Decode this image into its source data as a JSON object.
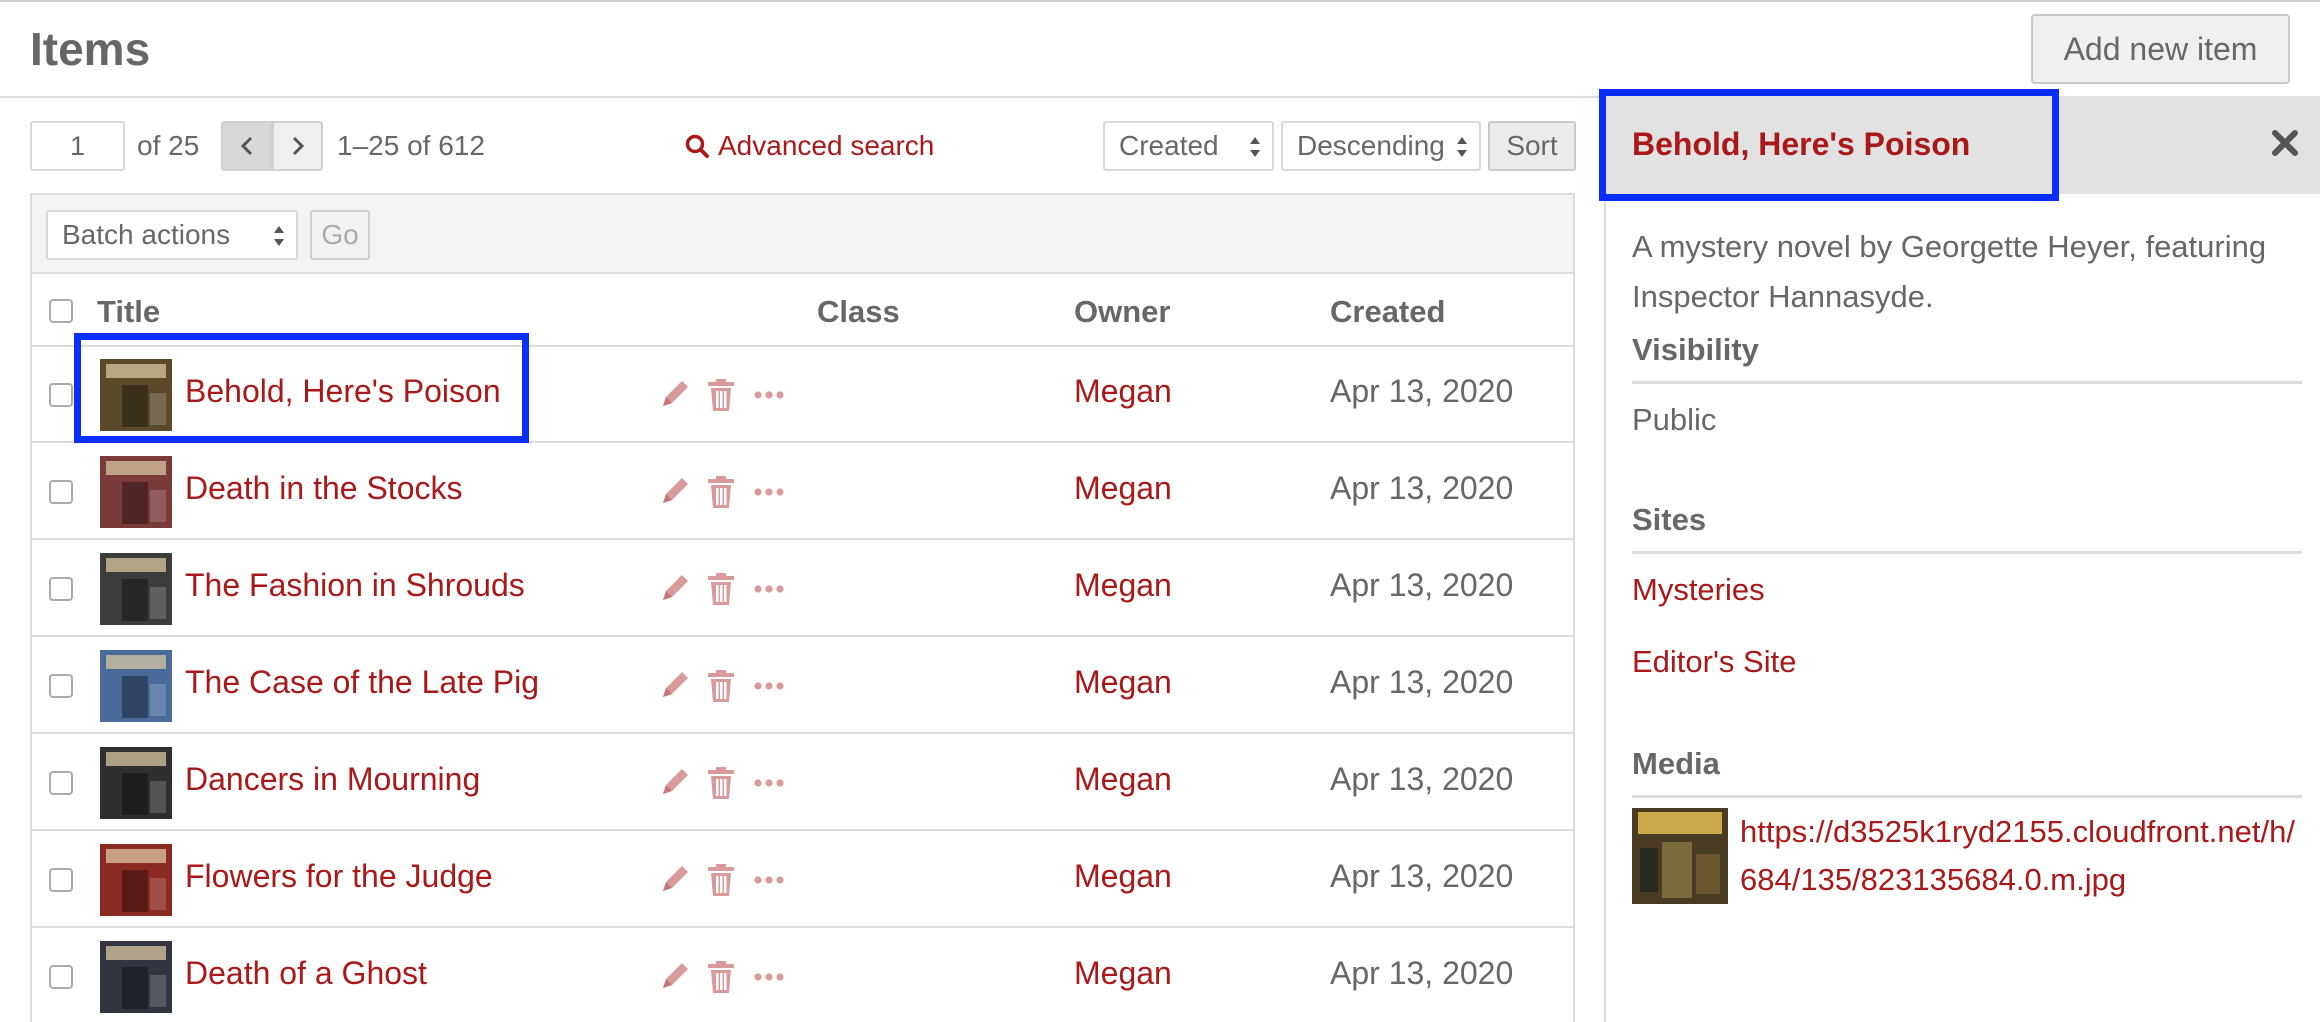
{
  "header": {
    "title": "Items",
    "add_button": "Add new item"
  },
  "pagination": {
    "current_page": "1",
    "of_pages": "of 25",
    "range": "1–25 of 612"
  },
  "search": {
    "advanced_label": "Advanced search"
  },
  "sort": {
    "sort_by": "Created",
    "order": "Descending",
    "button": "Sort"
  },
  "batch": {
    "select_label": "Batch actions",
    "go_button": "Go"
  },
  "table": {
    "columns": {
      "title": "Title",
      "class": "Class",
      "owner": "Owner",
      "created": "Created"
    },
    "rows": [
      {
        "title": "Behold, Here's Poison",
        "owner": "Megan",
        "created": "Apr 13, 2020",
        "thumb_color": "#5b4a2a"
      },
      {
        "title": "Death in the Stocks",
        "owner": "Megan",
        "created": "Apr 13, 2020",
        "thumb_color": "#7a3a3a"
      },
      {
        "title": "The Fashion in Shrouds",
        "owner": "Megan",
        "created": "Apr 13, 2020",
        "thumb_color": "#3c3c3c"
      },
      {
        "title": "The Case of the Late Pig",
        "owner": "Megan",
        "created": "Apr 13, 2020",
        "thumb_color": "#4a6b9a"
      },
      {
        "title": "Dancers in Mourning",
        "owner": "Megan",
        "created": "Apr 13, 2020",
        "thumb_color": "#2f2f2f"
      },
      {
        "title": "Flowers for the Judge",
        "owner": "Megan",
        "created": "Apr 13, 2020",
        "thumb_color": "#8a2a22"
      },
      {
        "title": "Death of a Ghost",
        "owner": "Megan",
        "created": "Apr 13, 2020",
        "thumb_color": "#303540"
      }
    ]
  },
  "sidebar": {
    "title": "Behold, Here's Poison",
    "description": "A mystery novel by Georgette Heyer, featuring Inspector Hannasyde.",
    "visibility_heading": "Visibility",
    "visibility_value": "Public",
    "sites_heading": "Sites",
    "sites": [
      "Mysteries",
      "Editor's Site"
    ],
    "media_heading": "Media",
    "media_url": "https://d3525k1ryd2155.cloudfront.net/h/684/135/823135684.0.m.jpg"
  },
  "colors": {
    "link": "#a91919",
    "text": "#676767",
    "focus": "#0a2eff",
    "panel_header": "#e2e2e2"
  }
}
